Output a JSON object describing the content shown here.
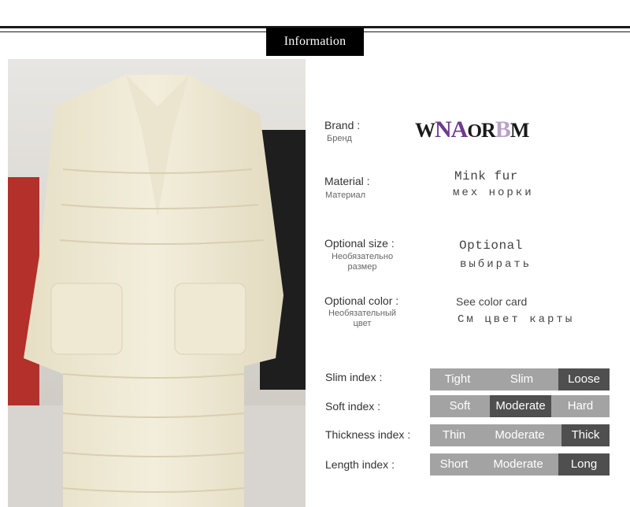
{
  "header": {
    "tab_label": "Information"
  },
  "brand": {
    "label": "Brand :",
    "sublabel": "Бренд",
    "logo": {
      "p1": "W",
      "p2": "NA",
      "p3": "O",
      "p4": "R",
      "p5": "B",
      "p6": "M"
    }
  },
  "material": {
    "label": "Material :",
    "sublabel": "Материал",
    "value_en": "Mink fur",
    "value_ru": "мех норки"
  },
  "size": {
    "label": "Optional size :",
    "sublabel": "Необязательно размер",
    "value_en": "Optional",
    "value_ru": "выбирать"
  },
  "color": {
    "label": "Optional color :",
    "sublabel": "Необязательный цвет",
    "value_en": "See color card",
    "value_ru": "См цвет карты"
  },
  "indices": [
    {
      "label": "Slim index :",
      "options": [
        "Tight",
        "Slim",
        "Loose"
      ],
      "selected": 2
    },
    {
      "label": "Soft index :",
      "options": [
        "Soft",
        "Moderate",
        "Hard"
      ],
      "selected": 1
    },
    {
      "label": "Thickness index :",
      "options": [
        "Thin",
        "Moderate",
        "Thick"
      ],
      "selected": 2
    },
    {
      "label": "Length index :",
      "options": [
        "Short",
        "Moderate",
        "Long"
      ],
      "selected": 2
    }
  ],
  "colors": {
    "selected": "#4f4f4f",
    "unselected": "#a3a3a3",
    "brand_purple": "#6d3a8c",
    "brand_lilac": "#b9a2c8"
  }
}
